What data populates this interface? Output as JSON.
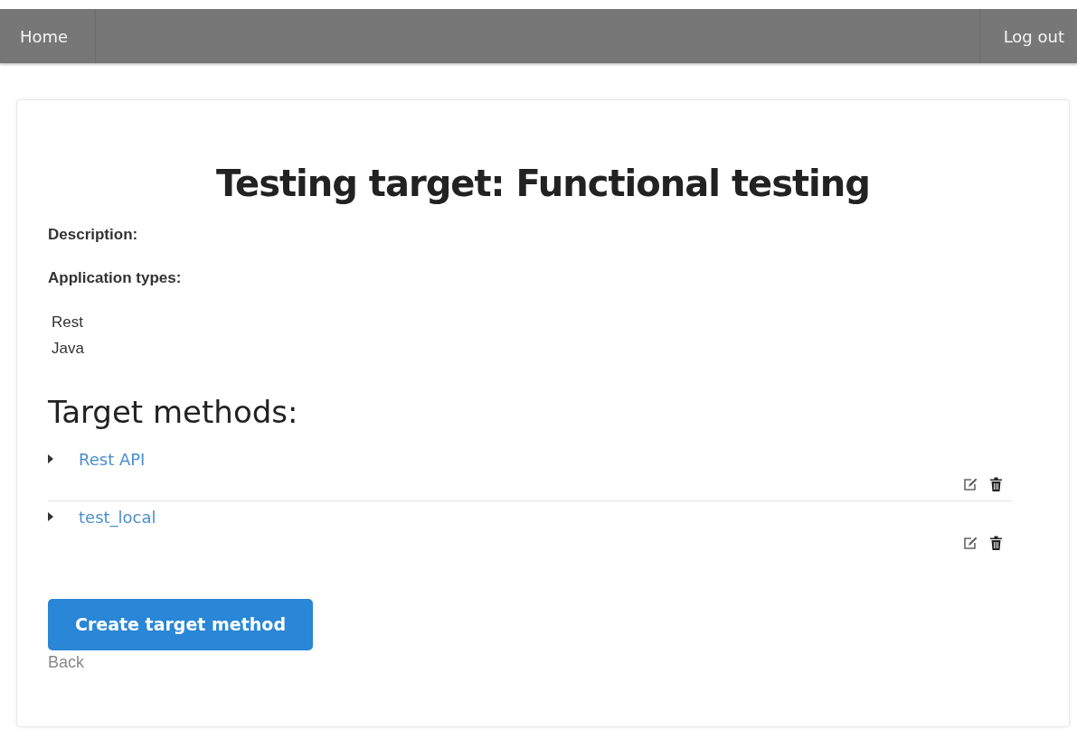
{
  "navbar": {
    "home": "Home",
    "logout": "Log out"
  },
  "title": "Testing target: Functional testing",
  "description_label": "Description:",
  "application_types_label": "Application types:",
  "application_types": [
    "Rest",
    "Java"
  ],
  "methods_heading": "Target methods:",
  "methods": [
    {
      "name": "Rest API",
      "expanded": false
    },
    {
      "name": "test_local",
      "expanded": false
    }
  ],
  "create_button": "Create target method",
  "back_link": "Back"
}
